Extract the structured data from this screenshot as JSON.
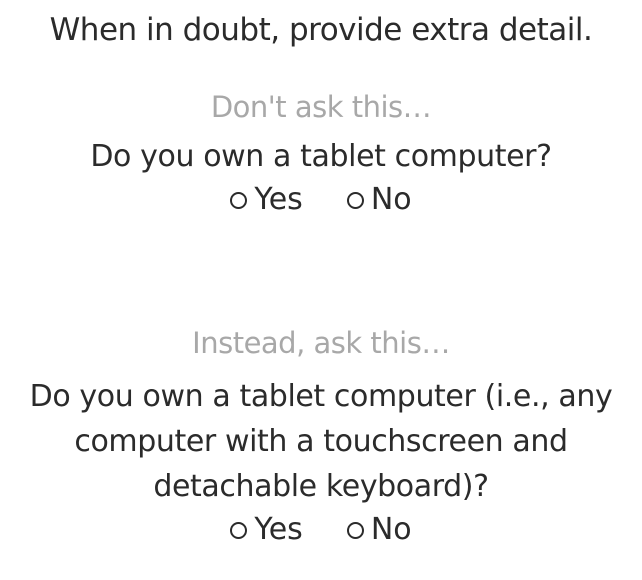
{
  "title": "When in doubt, provide extra detail.",
  "bad_example": {
    "label": "Don't ask this…",
    "question": "Do you own a tablet computer?",
    "options": [
      "Yes",
      "No"
    ]
  },
  "good_example": {
    "label": "Instead, ask this…",
    "question": "Do you own a tablet computer (i.e., any computer with a touchscreen and detachable keyboard)?",
    "options": [
      "Yes",
      "No"
    ]
  }
}
